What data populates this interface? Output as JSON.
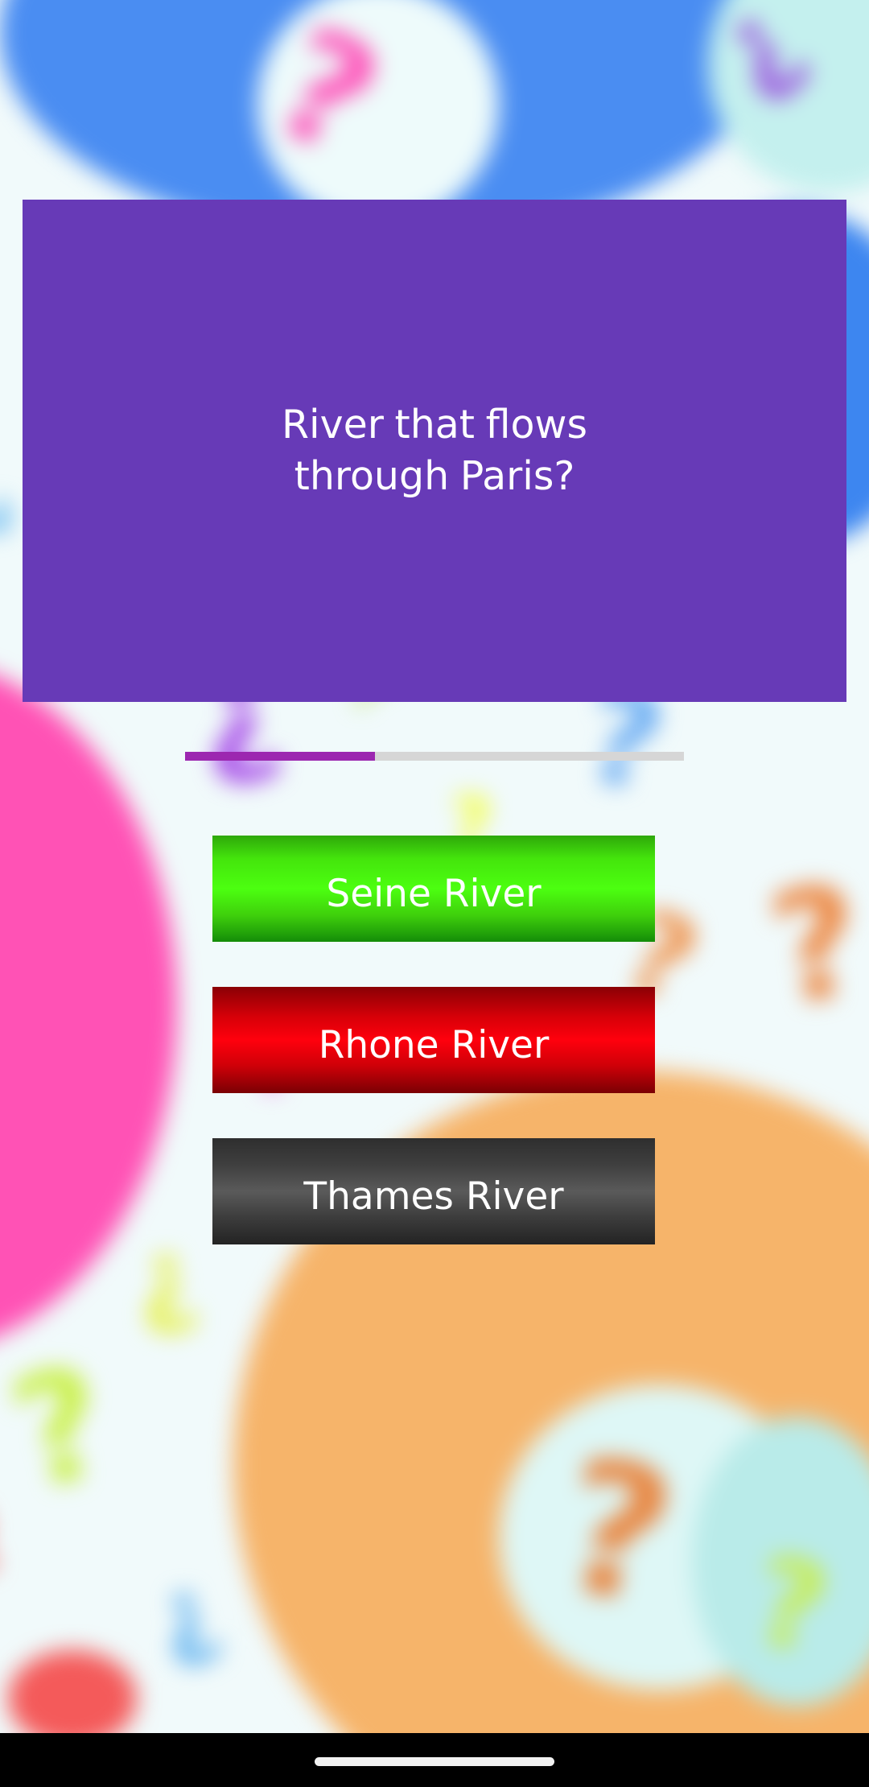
{
  "quiz": {
    "question": "River that flows through Paris?",
    "progress_fraction": 0.38,
    "answers": [
      {
        "label": "Seine River",
        "state": "correct",
        "color": "#4cff10"
      },
      {
        "label": "Rhone River",
        "state": "wrong",
        "color": "#ff000d"
      },
      {
        "label": "Thames River",
        "state": "neutral",
        "color": "#5a5a5a"
      }
    ]
  },
  "theme": {
    "card_color": "#673ab7",
    "progress_color": "#9c27b0",
    "progress_track_color": "#d6d6d6",
    "background_icon": "question-mark-pattern"
  }
}
